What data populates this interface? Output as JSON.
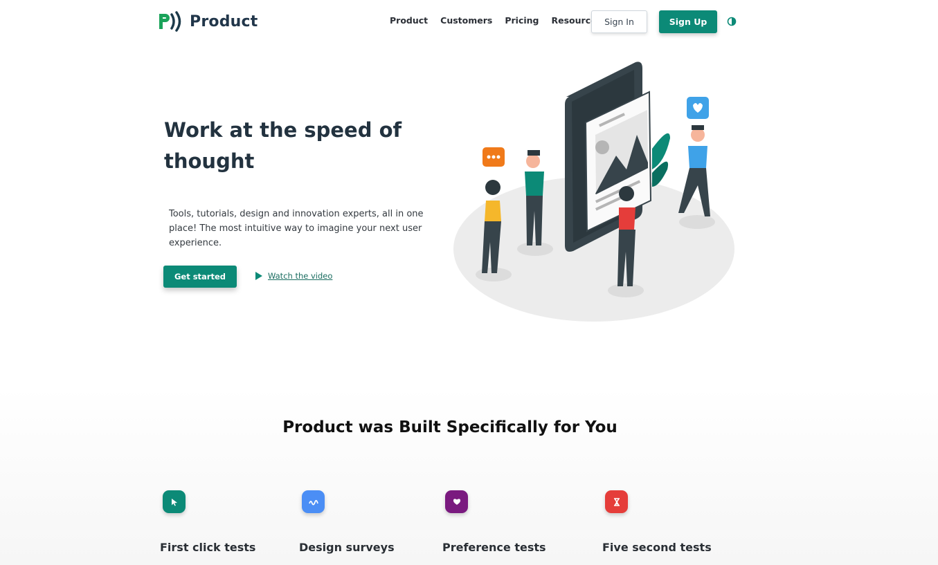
{
  "brand": {
    "name": "Product"
  },
  "nav": {
    "items": [
      "Product",
      "Customers",
      "Pricing",
      "Resources"
    ],
    "sign_in": "Sign In",
    "sign_up": "Sign Up"
  },
  "hero": {
    "title": "Work at the speed of thought",
    "description": "Tools, tutorials, design and innovation experts, all in one place! The most intuitive way to imagine your next user experience.",
    "cta": "Get started",
    "video_link": "Watch the video"
  },
  "features": {
    "title": "Product was Built Specifically for You",
    "items": [
      {
        "label": "First click tests",
        "icon": "cursor-icon",
        "color": "#0c8a77"
      },
      {
        "label": "Design surveys",
        "icon": "survey-icon",
        "color": "#4b8ef5"
      },
      {
        "label": "Preference tests",
        "icon": "heart-icon",
        "color": "#7a1a7f"
      },
      {
        "label": "Five second tests",
        "icon": "hourglass-icon",
        "color": "#e53d3a"
      }
    ]
  },
  "colors": {
    "accent": "#0c8a77",
    "heading": "#22323f"
  }
}
